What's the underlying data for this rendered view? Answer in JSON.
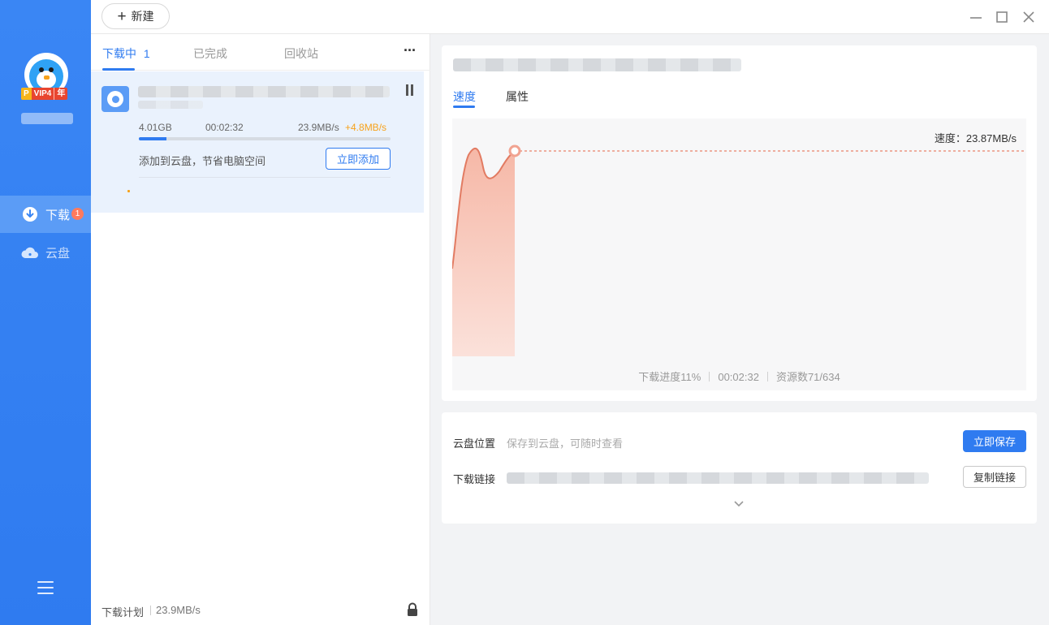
{
  "sidebar": {
    "vip_badge": {
      "p": "P",
      "level": "VIP4",
      "period": "年"
    },
    "nav": [
      {
        "label": "下载",
        "badge": "1",
        "icon": "download-icon"
      },
      {
        "label": "云盘",
        "icon": "cloud-icon"
      }
    ],
    "menu_icon": "menu-icon"
  },
  "topbar": {
    "new_label": "新建"
  },
  "tabs": [
    {
      "label": "下载中",
      "count": "1"
    },
    {
      "label": "已完成"
    },
    {
      "label": "回收站"
    }
  ],
  "more_label": "···",
  "download_item": {
    "size": "4.01GB",
    "elapsed": "00:02:32",
    "speed": "23.9MB/s",
    "speed_boost": "+4.8MB/s",
    "progress_fraction": 0.11,
    "cloud_tip": "添加到云盘，节省电脑空间",
    "add_label": "立即添加"
  },
  "plan_bar": {
    "label": "下载计划",
    "speed": "23.9MB/s"
  },
  "detail": {
    "tabs": [
      "速度",
      "属性"
    ],
    "speed_label": "速度：23.87MB/s",
    "footer": {
      "progress": "下载进度11%",
      "elapsed": "00:02:32",
      "sources": "资源数71/634"
    },
    "accent_color": "#e8836a"
  },
  "link_card": {
    "cloud_location_label": "云盘位置",
    "cloud_location_desc": "保存到云盘，可随时查看",
    "save_label": "立即保存",
    "download_link_label": "下载链接",
    "copy_label": "复制链接"
  },
  "colors": {
    "primary": "#2f7bf0",
    "sidebar": "#3a86f4",
    "boost": "#f7a21b"
  }
}
